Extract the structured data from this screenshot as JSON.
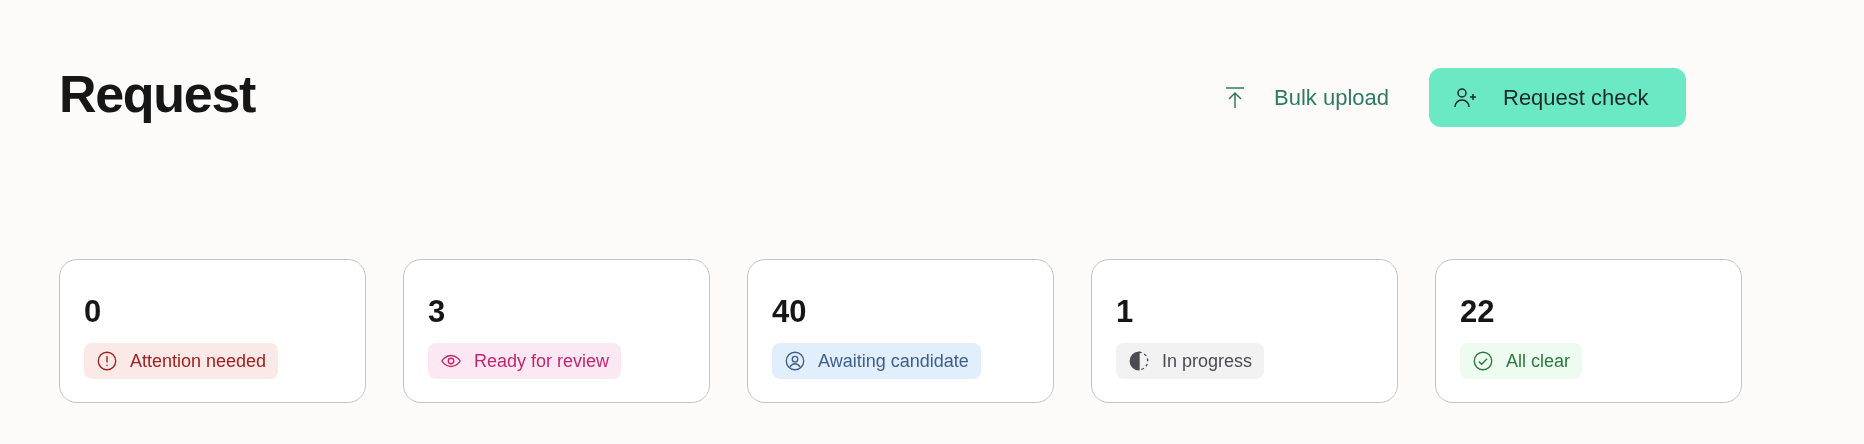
{
  "title": "Request",
  "actions": [
    {
      "label": "Bulk upload",
      "kind": "upload"
    },
    {
      "label": "Request check",
      "kind": "primary"
    }
  ],
  "cards": [
    {
      "count": "0",
      "status": "Attention needed",
      "kind": "alert",
      "color": "#a3201c"
    },
    {
      "count": "3",
      "status": "Ready for review",
      "kind": "eye",
      "color": "#c4266e"
    },
    {
      "count": "40",
      "status": "Awaiting candidate",
      "kind": "person",
      "color": "#3f5f8a"
    },
    {
      "count": "1",
      "status": "In progress",
      "kind": "half",
      "color": "#4b4b52"
    },
    {
      "count": "22",
      "status": "All clear",
      "kind": "check",
      "color": "#2b7a3e"
    }
  ]
}
